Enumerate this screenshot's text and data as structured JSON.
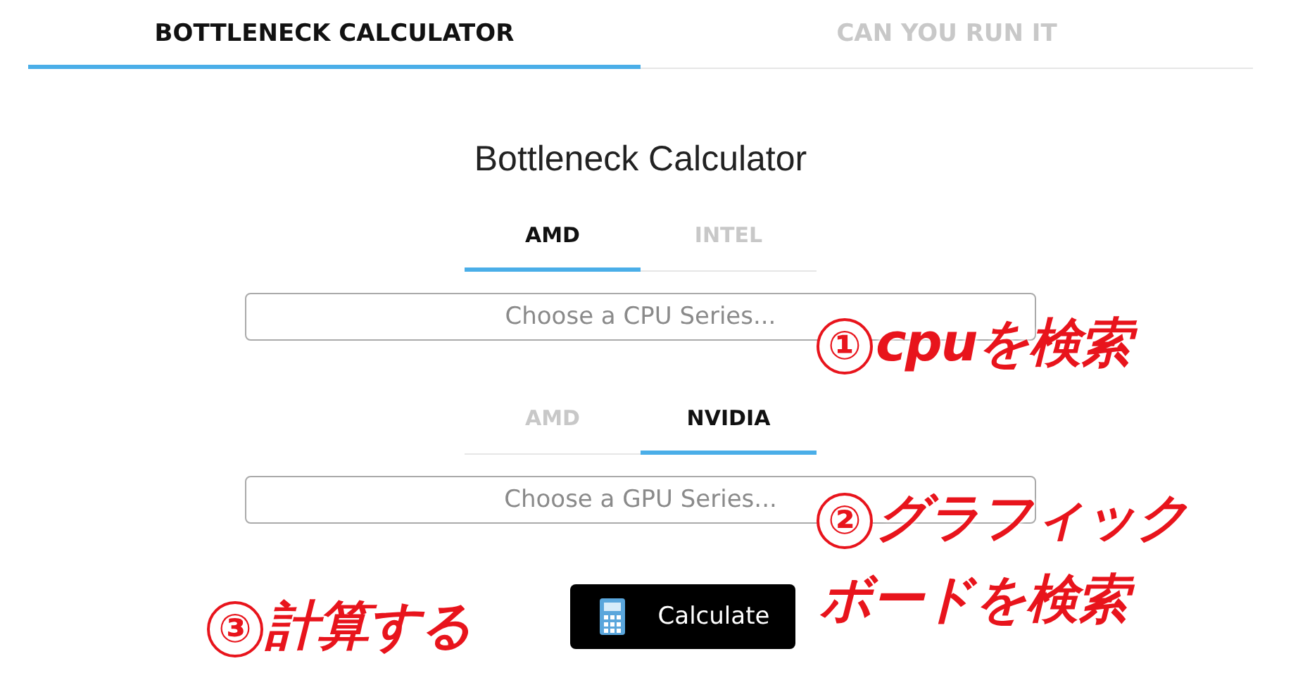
{
  "main_tabs": [
    {
      "label": "BOTTLENECK CALCULATOR",
      "selected": true
    },
    {
      "label": "CAN YOU RUN IT",
      "selected": false
    }
  ],
  "title": "Bottleneck Calculator",
  "cpu": {
    "tabs": [
      {
        "label": "AMD",
        "selected": true
      },
      {
        "label": "INTEL",
        "selected": false
      }
    ],
    "placeholder": "Choose a CPU Series..."
  },
  "gpu": {
    "tabs": [
      {
        "label": "AMD",
        "selected": false
      },
      {
        "label": "NVIDIA",
        "selected": true
      }
    ],
    "placeholder": "Choose a GPU Series..."
  },
  "calculate_button": "Calculate",
  "annotations": [
    {
      "mark": "①",
      "text": "cpuを検索"
    },
    {
      "mark": "②",
      "text": "グラフィック"
    },
    {
      "text": "ボードを検索"
    },
    {
      "mark": "③",
      "text": "計算する"
    }
  ]
}
